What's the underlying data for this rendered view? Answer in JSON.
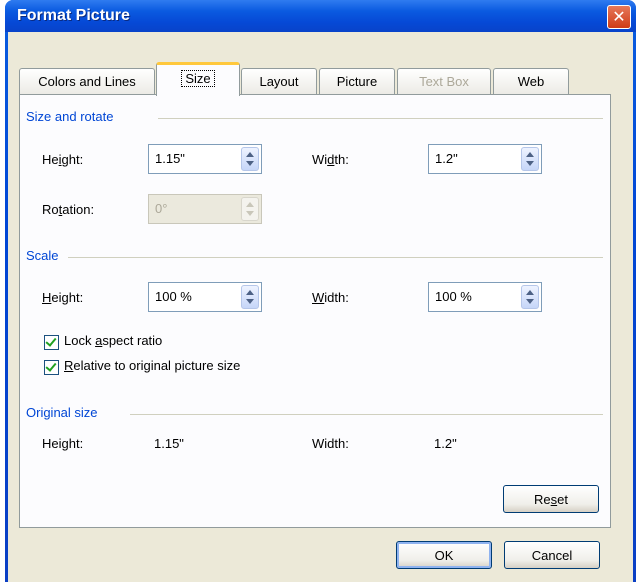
{
  "window": {
    "title": "Format Picture"
  },
  "tabs": [
    {
      "label": "Colors and Lines",
      "state": "normal"
    },
    {
      "label": "Size",
      "state": "active"
    },
    {
      "label": "Layout",
      "state": "normal"
    },
    {
      "label": "Picture",
      "state": "normal"
    },
    {
      "label": "Text Box",
      "state": "disabled"
    },
    {
      "label": "Web",
      "state": "normal"
    }
  ],
  "size_rotate": {
    "header": "Size and rotate",
    "height_label_pre": "He",
    "height_label_u": "i",
    "height_label_post": "ght:",
    "height_value": "1.15\"",
    "width_label_pre": "Wi",
    "width_label_u": "d",
    "width_label_post": "th:",
    "width_value": "1.2\"",
    "rotation_label_pre": "Ro",
    "rotation_label_u": "t",
    "rotation_label_post": "ation:",
    "rotation_value": "0°"
  },
  "scale": {
    "header": "Scale",
    "height_label_u": "H",
    "height_label_post": "eight:",
    "height_value": "100 %",
    "width_label_u": "W",
    "width_label_post": "idth:",
    "width_value": "100 %",
    "lock_pre": "Lock ",
    "lock_u": "a",
    "lock_post": "spect ratio",
    "lock_checked": true,
    "relative_u": "R",
    "relative_post": "elative to original picture size",
    "relative_checked": true
  },
  "original": {
    "header": "Original size",
    "height_label": "Height:",
    "height_value": "1.15\"",
    "width_label": "Width:",
    "width_value": "1.2\""
  },
  "buttons": {
    "reset_pre": "Re",
    "reset_u": "s",
    "reset_post": "et",
    "ok": "OK",
    "cancel": "Cancel"
  },
  "colors": {
    "accent": "#0046d5",
    "titlebar": "#0a5ae0",
    "dialog_bg": "#ece9d8",
    "check": "#21a121",
    "tab_highlight": "#ffc83c"
  },
  "icons": [
    "close-icon",
    "spin-up-icon",
    "spin-down-icon",
    "checkmark-icon"
  ]
}
